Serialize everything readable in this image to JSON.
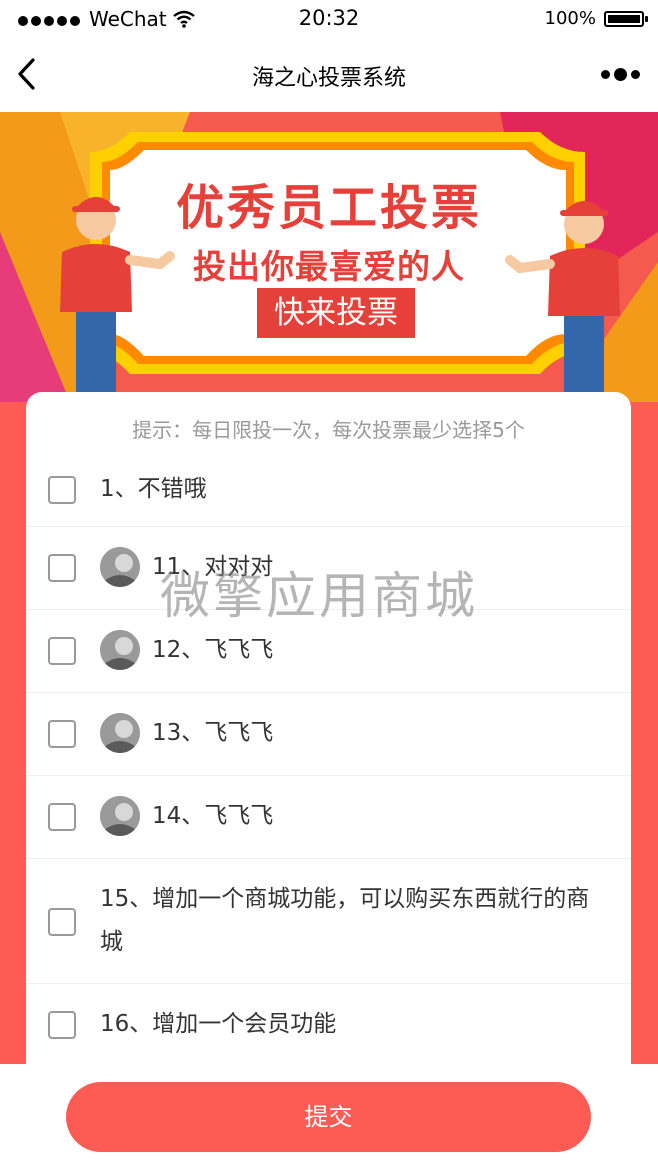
{
  "status_bar": {
    "carrier": "WeChat",
    "time": "20:32",
    "battery": "100%",
    "battery_level": 1.0
  },
  "nav": {
    "title": "海之心投票系统",
    "back_icon": "chevron-left-icon",
    "more_icon": "more-dots-icon"
  },
  "banner": {
    "headline": "优秀员工投票",
    "subline": "投出你最喜爱的人",
    "button_text": "快来投票"
  },
  "vote": {
    "tip": "提示：每日限投一次，每次投票最少选择5个",
    "items": [
      {
        "label": "1、不错哦",
        "has_avatar": false
      },
      {
        "label": "11、对对对",
        "has_avatar": true
      },
      {
        "label": "12、飞飞飞",
        "has_avatar": true
      },
      {
        "label": "13、飞飞飞",
        "has_avatar": true
      },
      {
        "label": "14、飞飞飞",
        "has_avatar": true
      },
      {
        "label_line1": "15、增加一个商城功能，可以购买东西就行的商",
        "label_line2": "城",
        "has_avatar": false
      },
      {
        "label": "16、增加一个会员功能",
        "has_avatar": false
      }
    ]
  },
  "watermark": "微擎应用商城",
  "submit": {
    "label": "提交"
  },
  "colors": {
    "accent": "#ff5b55",
    "banner_red": "#e5403a",
    "banner_yellow": "#ffd000",
    "banner_orange": "#f39a1a"
  }
}
